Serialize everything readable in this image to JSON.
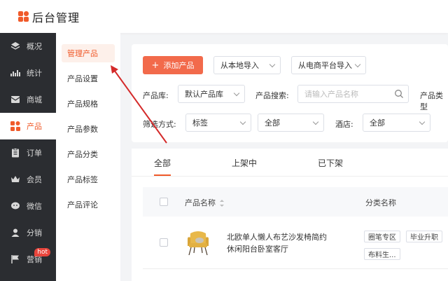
{
  "app": {
    "title": "后台管理"
  },
  "left_nav": [
    {
      "label": "概况",
      "icon": "layers-icon"
    },
    {
      "label": "统计",
      "icon": "chart-icon"
    },
    {
      "label": "商城",
      "icon": "mail-icon"
    },
    {
      "label": "产品",
      "icon": "grid-icon",
      "active": true
    },
    {
      "label": "订单",
      "icon": "clipboard-icon"
    },
    {
      "label": "会员",
      "icon": "crown-icon"
    },
    {
      "label": "微信",
      "icon": "chat-icon"
    },
    {
      "label": "分销",
      "icon": "user-icon"
    },
    {
      "label": "营销",
      "icon": "flag-icon",
      "badge": "hot"
    }
  ],
  "sub_nav": [
    {
      "label": "管理产品",
      "active": true
    },
    {
      "label": "产品设置"
    },
    {
      "label": "产品规格"
    },
    {
      "label": "产品参数"
    },
    {
      "label": "产品分类"
    },
    {
      "label": "产品标签"
    },
    {
      "label": "产品评论"
    }
  ],
  "toolbar": {
    "add_label": "添加产品",
    "import_local": "从本地导入",
    "import_platform": "从电商平台导入"
  },
  "filters": {
    "library_label": "产品库:",
    "library_value": "默认产品库",
    "search_label": "产品搜索:",
    "search_placeholder": "请输入产品名称",
    "type_label": "产品类型",
    "method_label": "筛选方式:",
    "method_value": "标签",
    "method_sub_value": "全部",
    "hotel_label": "酒店:",
    "hotel_value": "全部"
  },
  "tabs": [
    {
      "label": "全部",
      "active": true
    },
    {
      "label": "上架中"
    },
    {
      "label": "已下架"
    }
  ],
  "table": {
    "columns": [
      "产品名称",
      "分类名称"
    ],
    "rows": [
      {
        "name": "北欧单人懒人布艺沙发椅简约休闲阳台卧室客厅",
        "tags": [
          "圈笔专区",
          "毕业升职",
          "布料生..."
        ]
      }
    ]
  },
  "colors": {
    "accent": "#f05a2a",
    "sidebar": "#2b2d31"
  }
}
